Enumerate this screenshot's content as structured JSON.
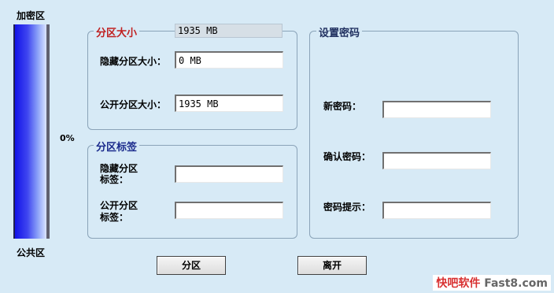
{
  "meter": {
    "top_label": "加密区",
    "bottom_label": "公共区",
    "percent": "0%",
    "encrypted_fraction": 0
  },
  "partition_size": {
    "title": "分区大小",
    "total_value": "1935 MB",
    "hidden_label": "隐藏分区大小：",
    "hidden_value": "0 MB",
    "public_label": "公开分区大小：",
    "public_value": "1935 MB"
  },
  "partition_label": {
    "title": "分区标签",
    "hidden_label_line1": "隐藏分区",
    "hidden_label_line2": "标签：",
    "hidden_value": "",
    "public_label_line1": "公开分区",
    "public_label_line2": "标签：",
    "public_value": ""
  },
  "password": {
    "title": "设置密码",
    "new_label": "新密码：",
    "new_value": "",
    "confirm_label": "确认密码：",
    "confirm_value": "",
    "hint_label": "密码提示：",
    "hint_value": ""
  },
  "buttons": {
    "partition": "分区",
    "exit": "离开"
  },
  "watermark": {
    "part1": "快吧软件",
    "part2": "Fast8.com"
  },
  "colors": {
    "background": "#d7eaf6",
    "meter_blue": "#1212e8",
    "title_red": "#c02020",
    "title_blue": "#1a2a8c"
  }
}
